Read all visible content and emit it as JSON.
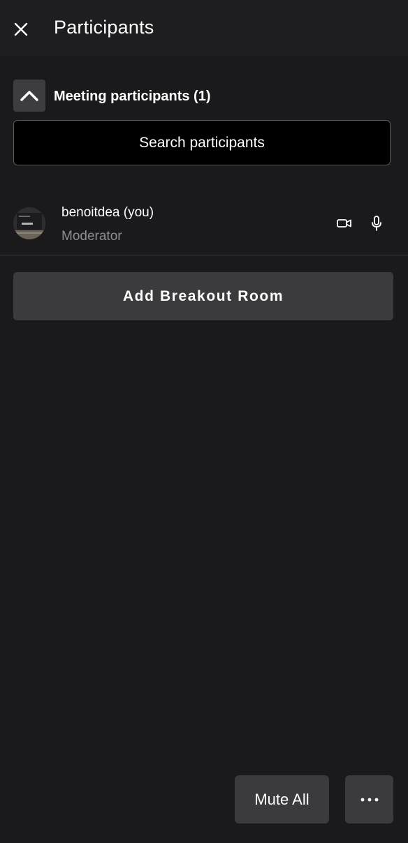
{
  "header": {
    "title": "Participants",
    "close_icon": "close-icon"
  },
  "section": {
    "title": "Meeting participants (1)",
    "collapse_icon": "chevron-up-icon",
    "expanded": true
  },
  "search": {
    "placeholder": "Search participants",
    "value": ""
  },
  "participants": [
    {
      "name": "benoitdea (you)",
      "role": "Moderator",
      "avatar": "avatar-photo",
      "icons": [
        "video-camera-icon",
        "microphone-icon"
      ]
    }
  ],
  "breakout": {
    "label": "Add Breakout Room"
  },
  "footer": {
    "mute_all_label": "Mute All",
    "more_icon": "more-horizontal-icon"
  },
  "colors": {
    "background": "#1a1a1c",
    "header_background": "#1e1e20",
    "button_background": "#3b3b3e",
    "secondary_text": "#8d8d92"
  }
}
